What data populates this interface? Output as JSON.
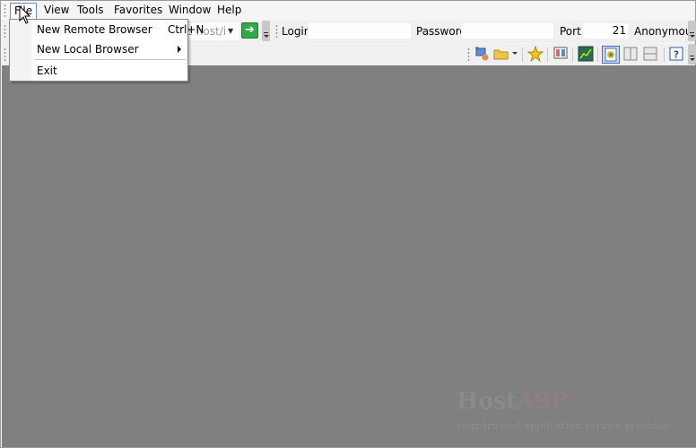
{
  "menubar": {
    "items": [
      {
        "label": "File"
      },
      {
        "label": "View"
      },
      {
        "label": "Tools"
      },
      {
        "label": "Favorites"
      },
      {
        "label": "Window"
      },
      {
        "label": "Help"
      }
    ]
  },
  "connection": {
    "host_placeholder": "he host/i",
    "login_label": "Login",
    "login_value": "",
    "password_label": "Password",
    "password_value": "",
    "port_label": "Port",
    "port_value": "21",
    "anonymous_label": "Anonymous"
  },
  "file_menu": {
    "items": [
      {
        "label": "New Remote Browser",
        "shortcut": "Ctrl+N"
      },
      {
        "label": "New Local Browser",
        "has_submenu": true
      },
      {
        "label": "Exit"
      }
    ]
  },
  "watermark": {
    "title_part1": "Host",
    "title_part2": "ASP",
    "subtitle": "your trusted application service provider"
  },
  "colors": {
    "workspace": "#808080",
    "go_button": "#2fa84a",
    "menu_highlight_border": "#6a8ccb"
  },
  "icons": [
    "remote-browser-icon",
    "local-folder-icon",
    "favorites-star-icon",
    "layout-icon",
    "chart-icon",
    "view-mode-icon",
    "help-icon"
  ]
}
